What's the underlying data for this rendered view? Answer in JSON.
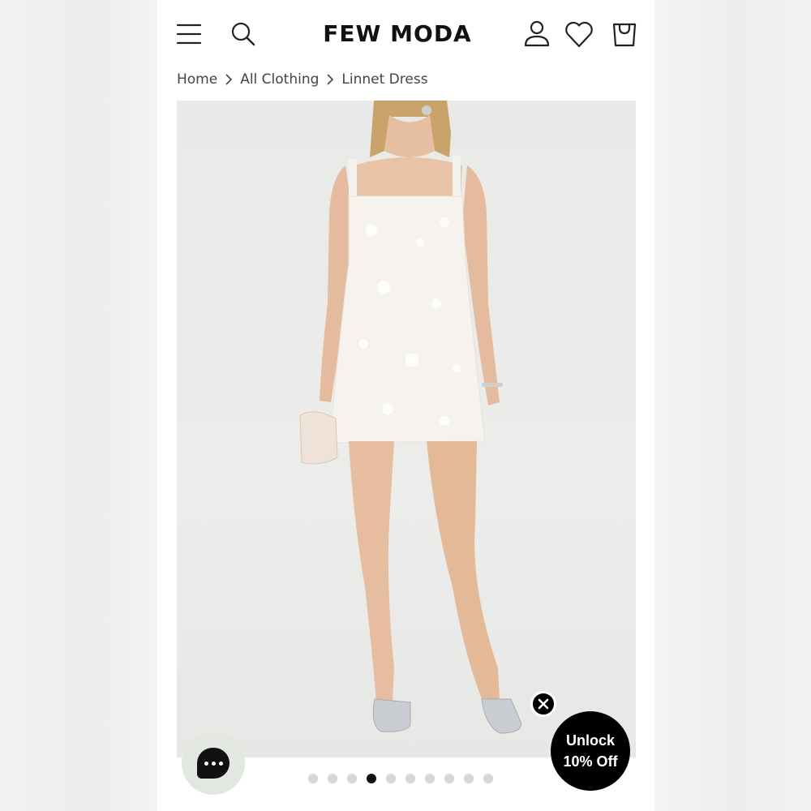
{
  "header": {
    "logo": "FEW MODA",
    "icons": [
      "menu-icon",
      "search-icon",
      "account-icon",
      "wishlist-heart-icon",
      "cart-bag-icon"
    ]
  },
  "breadcrumb": {
    "items": [
      "Home",
      "All Clothing",
      "Linnet Dress"
    ]
  },
  "gallery": {
    "image_alt": "Model wearing a white sequined tweed mini dress with silver ballet flats",
    "slide_count": 10,
    "active_slide": 4
  },
  "chat": {
    "icon": "chat-bubble-icon"
  },
  "promo": {
    "line1": "Unlock",
    "line2": "10% Off"
  },
  "colors": {
    "brand_text": "#111111",
    "promo_bg": "#000000",
    "dot_inactive": "#d6d6d6",
    "dot_active": "#111111",
    "gallery_bg": "#e9e9e8"
  }
}
